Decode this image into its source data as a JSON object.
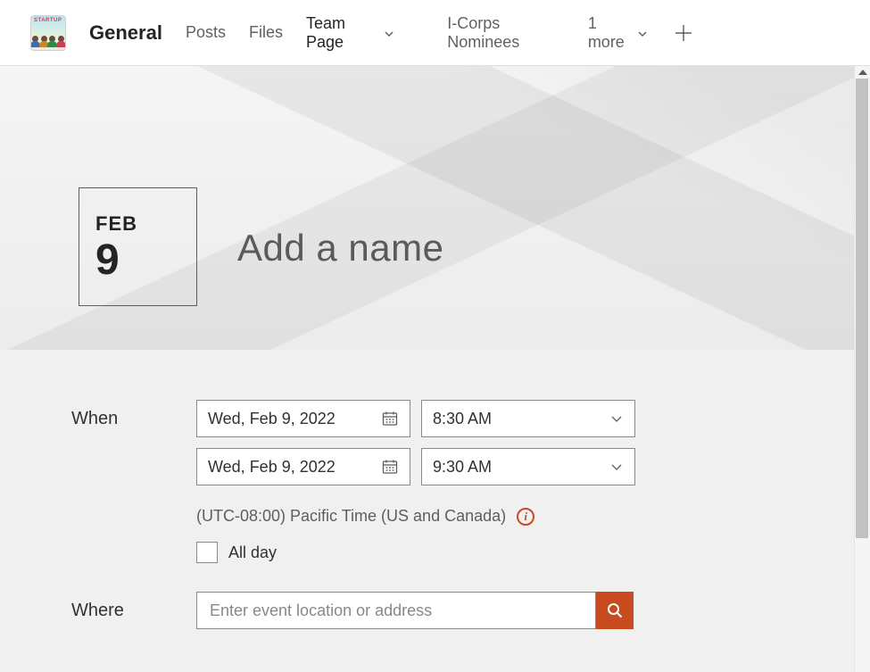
{
  "header": {
    "channel_name": "General",
    "tabs": {
      "posts": "Posts",
      "files": "Files",
      "team_page": "Team Page",
      "icorps": "I-Corps Nominees",
      "more": "1 more"
    }
  },
  "event": {
    "badge_month": "FEB",
    "badge_day": "9",
    "title_placeholder": "Add a name"
  },
  "form": {
    "when_label": "When",
    "where_label": "Where",
    "start_date": "Wed, Feb 9, 2022",
    "start_time": "8:30 AM",
    "end_date": "Wed, Feb 9, 2022",
    "end_time": "9:30 AM",
    "timezone": "(UTC-08:00) Pacific Time (US and Canada)",
    "all_day_label": "All day",
    "location_placeholder": "Enter event location or address"
  }
}
